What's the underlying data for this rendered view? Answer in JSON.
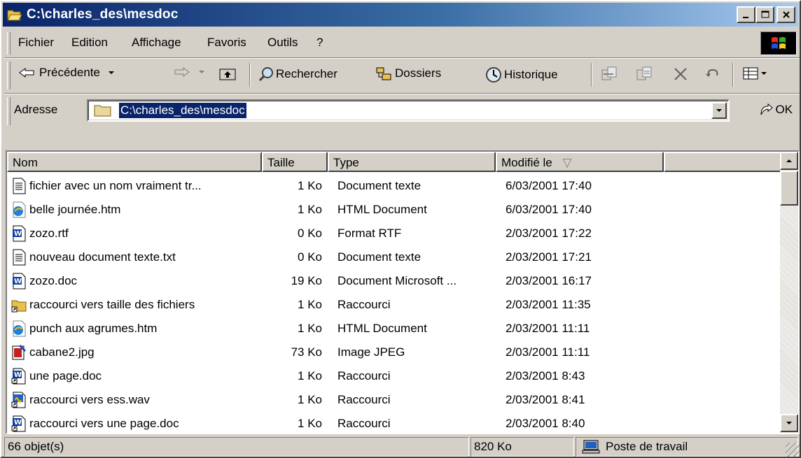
{
  "window": {
    "title": "C:\\charles_des\\mesdoc",
    "controls": {
      "minimize": "_",
      "maximize": "□",
      "close": "✕"
    }
  },
  "menu": {
    "items": [
      "Fichier",
      "Edition",
      "Affichage",
      "Favoris",
      "Outils",
      "?"
    ]
  },
  "toolbar": {
    "back_label": "Précédente",
    "search_label": "Rechercher",
    "folders_label": "Dossiers",
    "history_label": "Historique"
  },
  "address": {
    "label": "Adresse",
    "value": "C:\\charles_des\\mesdoc",
    "go_label": "OK"
  },
  "list": {
    "columns": [
      "Nom",
      "Taille",
      "Type",
      "Modifié le"
    ],
    "sort_indicator": "▽",
    "rows": [
      {
        "icon": "text-file-icon",
        "name": "fichier avec un nom vraiment tr...",
        "size": "1 Ko",
        "type": "Document texte",
        "modified": "6/03/2001 17:40"
      },
      {
        "icon": "html-file-icon",
        "name": "belle journée.htm",
        "size": "1 Ko",
        "type": "HTML Document",
        "modified": "6/03/2001 17:40"
      },
      {
        "icon": "word-file-icon",
        "name": "zozo.rtf",
        "size": "0 Ko",
        "type": "Format RTF",
        "modified": "2/03/2001 17:22"
      },
      {
        "icon": "text-file-icon",
        "name": "nouveau document texte.txt",
        "size": "0 Ko",
        "type": "Document texte",
        "modified": "2/03/2001 17:21"
      },
      {
        "icon": "word-file-icon",
        "name": "zozo.doc",
        "size": "19 Ko",
        "type": "Document Microsoft ...",
        "modified": "2/03/2001 16:17"
      },
      {
        "icon": "folder-shortcut-icon",
        "name": "raccourci vers taille des fichiers",
        "size": "1 Ko",
        "type": "Raccourci",
        "modified": "2/03/2001 11:35"
      },
      {
        "icon": "html-file-icon",
        "name": "punch aux agrumes.htm",
        "size": "1 Ko",
        "type": "HTML Document",
        "modified": "2/03/2001 11:11"
      },
      {
        "icon": "image-file-icon",
        "name": "cabane2.jpg",
        "size": "73 Ko",
        "type": "Image JPEG",
        "modified": "2/03/2001 11:11"
      },
      {
        "icon": "word-shortcut-icon",
        "name": "une page.doc",
        "size": "1 Ko",
        "type": "Raccourci",
        "modified": "2/03/2001 8:43"
      },
      {
        "icon": "sound-shortcut-icon",
        "name": "raccourci vers ess.wav",
        "size": "1 Ko",
        "type": "Raccourci",
        "modified": "2/03/2001 8:41"
      },
      {
        "icon": "word-shortcut-icon",
        "name": "raccourci vers une page.doc",
        "size": "1 Ko",
        "type": "Raccourci",
        "modified": "2/03/2001 8:40"
      }
    ]
  },
  "status": {
    "objects": "66 objet(s)",
    "size": "820 Ko",
    "zone": "Poste de travail"
  },
  "colors": {
    "title_start": "#0a246a",
    "title_end": "#a6caf0",
    "face": "#d4d0c8",
    "selection": "#0a246a"
  }
}
